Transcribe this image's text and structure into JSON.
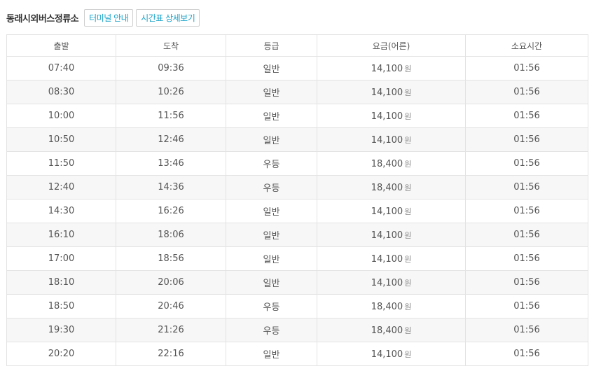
{
  "header": {
    "title": "동래시외버스정류소",
    "terminal_info_label": "터미널 안내",
    "timetable_detail_label": "시간표 상세보기"
  },
  "table": {
    "columns": [
      "출발",
      "도착",
      "등급",
      "요금(어른)",
      "소요시간"
    ],
    "currency_unit": "원",
    "rows": [
      {
        "depart": "07:40",
        "arrive": "09:36",
        "grade": "일반",
        "fare": "14,100",
        "duration": "01:56"
      },
      {
        "depart": "08:30",
        "arrive": "10:26",
        "grade": "일반",
        "fare": "14,100",
        "duration": "01:56"
      },
      {
        "depart": "10:00",
        "arrive": "11:56",
        "grade": "일반",
        "fare": "14,100",
        "duration": "01:56"
      },
      {
        "depart": "10:50",
        "arrive": "12:46",
        "grade": "일반",
        "fare": "14,100",
        "duration": "01:56"
      },
      {
        "depart": "11:50",
        "arrive": "13:46",
        "grade": "우등",
        "fare": "18,400",
        "duration": "01:56"
      },
      {
        "depart": "12:40",
        "arrive": "14:36",
        "grade": "우등",
        "fare": "18,400",
        "duration": "01:56"
      },
      {
        "depart": "14:30",
        "arrive": "16:26",
        "grade": "일반",
        "fare": "14,100",
        "duration": "01:56"
      },
      {
        "depart": "16:10",
        "arrive": "18:06",
        "grade": "일반",
        "fare": "14,100",
        "duration": "01:56"
      },
      {
        "depart": "17:00",
        "arrive": "18:56",
        "grade": "일반",
        "fare": "14,100",
        "duration": "01:56"
      },
      {
        "depart": "18:10",
        "arrive": "20:06",
        "grade": "일반",
        "fare": "14,100",
        "duration": "01:56"
      },
      {
        "depart": "18:50",
        "arrive": "20:46",
        "grade": "우등",
        "fare": "18,400",
        "duration": "01:56"
      },
      {
        "depart": "19:30",
        "arrive": "21:26",
        "grade": "우등",
        "fare": "18,400",
        "duration": "01:56"
      },
      {
        "depart": "20:20",
        "arrive": "22:16",
        "grade": "일반",
        "fare": "14,100",
        "duration": "01:56"
      }
    ]
  },
  "colors": {
    "accent": "#1aa3c8",
    "border": "#e3e3e3",
    "stripe": "#f7f7f7"
  }
}
